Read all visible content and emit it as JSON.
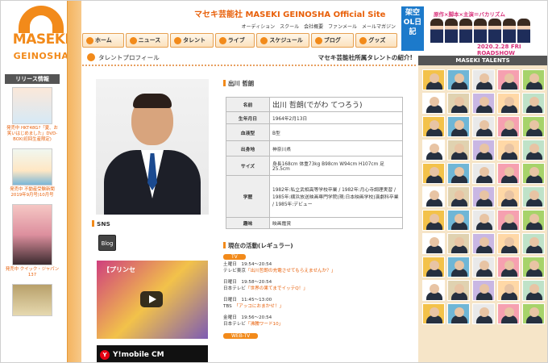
{
  "logo": {
    "word1": "MASEKI",
    "word2": "GEINOSHA"
  },
  "brand": "マセキ芸能社 MASEKI GEINOSHA Official Site",
  "topnav": [
    "オーディション",
    "スクール",
    "会社概要",
    "ファンメール",
    "メールマガジン"
  ],
  "banner": {
    "kanji": "架空OL日記",
    "pink": "原作×脚本×主演＝バカリズム",
    "date": "2020.2.28 FRI ROADSHOW"
  },
  "mainnav": [
    "ホーム",
    "ニュース",
    "タレント",
    "ライブ",
    "スケジュール",
    "ブログ",
    "グッズ"
  ],
  "release": {
    "title": "リリース情報",
    "items": [
      {
        "text": "発売中 HKT48G?「夏、お笑いはじめました」DVD-BOX(初回生産限定)"
      },
      {
        "text": "発売中 不動産受験新聞 2019年9月号)10月号"
      },
      {
        "text": "発売中 クイック・ジャパン137"
      }
    ]
  },
  "page": {
    "title": "タレントプロフィール",
    "right": "マセキ芸能社所属タレントの紹介!"
  },
  "profile": {
    "name_heading": "出川 哲朗",
    "rows": [
      {
        "key": "名前",
        "value": "出川 哲朗(でがわ てつろう)"
      },
      {
        "key": "生年月日",
        "value": "1964年2月13日"
      },
      {
        "key": "血液型",
        "value": "B型"
      },
      {
        "key": "出身地",
        "value": "神奈川県"
      },
      {
        "key": "サイズ",
        "value": "身長168cm 体重73kg B98cm W94cm H107cm 足25.5cm"
      },
      {
        "key": "学歴",
        "value": "1982年:私立武相高等学校卒業 / 1982年:月心寺調理実習 / 1985年:横浜放送映画専門学院(現:日本映画学校)演劇科卒業 / 1985年:デビュー"
      },
      {
        "key": "趣味",
        "value": "映画鑑賞"
      }
    ]
  },
  "sns": {
    "title": "SNS",
    "blog": "Blog"
  },
  "videos": [
    {
      "title": "【プリンセ"
    },
    {
      "title": "Y!mobile CM"
    }
  ],
  "activities": {
    "title": "現在の活動(レギュラー)",
    "tag": "TV",
    "tag2": "WEB-TV",
    "items": [
      {
        "day": "土曜日",
        "time": "19:54～20:54",
        "station": "テレビ東京",
        "program": "「出川哲朗の充電させてもらえませんか？」"
      },
      {
        "day": "日曜日",
        "time": "19:58～20:54",
        "station": "日本テレビ",
        "program": "「世界の果てまでイッテQ！」"
      },
      {
        "day": "日曜日",
        "time": "11:45～13:00",
        "station": "TBS",
        "program": "「アッコにおまかせ！」"
      },
      {
        "day": "金曜日",
        "time": "19:56～20:54",
        "station": "日本テレビ",
        "program": "「沸騰ワード10」"
      }
    ]
  },
  "talents": {
    "title": "MASEKI TALENTS",
    "count": 55
  }
}
